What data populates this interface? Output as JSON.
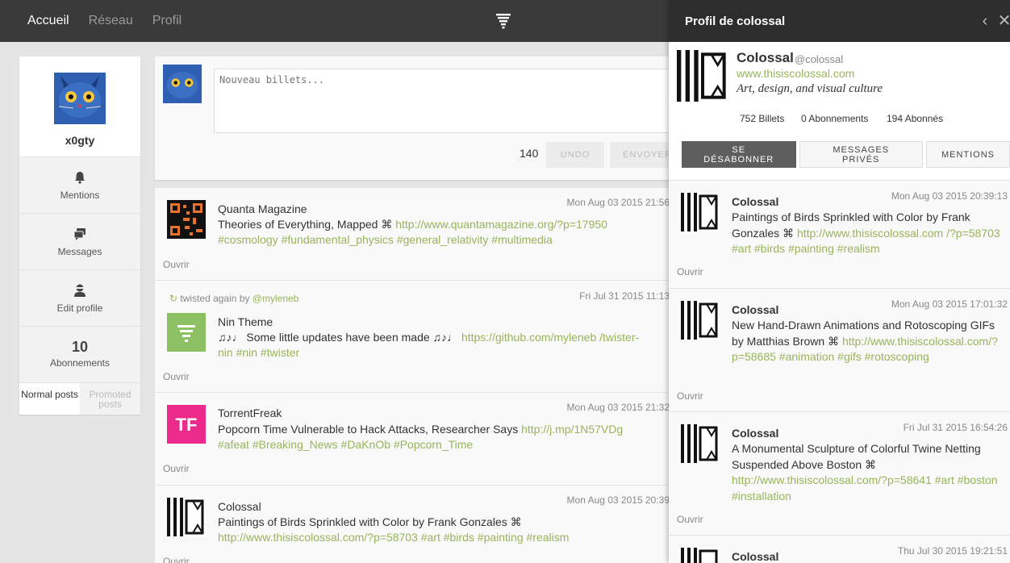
{
  "nav": {
    "items": [
      "Accueil",
      "Réseau",
      "Profil"
    ]
  },
  "user": {
    "name": "x0gty"
  },
  "sidebar": {
    "mentions": "Mentions",
    "messages": "Messages",
    "edit_profile": "Edit profile",
    "following_count": "10",
    "following_label": "Abonnements",
    "tab_normal": "Normal posts",
    "tab_promoted": "Promoted posts"
  },
  "composer": {
    "placeholder": "Nouveau billets...",
    "counter": "140",
    "undo": "UNDO",
    "send": "ENVOYER"
  },
  "feed": [
    {
      "name": "Quanta Magazine",
      "time": "Mon Aug 03 2015 21:56",
      "text": "Theories of Everything, Mapped ⌘ ",
      "link": "http://www.quantamagazine.org/?p=17950",
      "tags": "#cosmology #fundamental_physics #general_relativity #multimedia",
      "open": "Ouvrir"
    },
    {
      "retwist_prefix": "twisted again by ",
      "retwist_user": "@myleneb",
      "name": "Nin Theme",
      "time": "Fri Jul 31 2015 11:13",
      "text": "♫♪♩ Some little updates have been made ♫♪♩ ",
      "link": "https://github.com/myleneb /twister-nin",
      "tags": "#nin #twister",
      "open": "Ouvrir"
    },
    {
      "name": "TorrentFreak",
      "time": "Mon Aug 03 2015 21:32",
      "text": "Popcorn Time Vulnerable to Hack Attacks, Researcher Says ",
      "link": "http://j.mp/1N57VDg",
      "tags": "#afeat #Breaking_News #DaKnOb #Popcorn_Time",
      "open": "Ouvrir"
    },
    {
      "name": "Colossal",
      "time": "Mon Aug 03 2015 20:39",
      "text": "Paintings of Birds Sprinkled with Color by Frank Gonzales ⌘",
      "link": "http://www.thisiscolossal.com/?p=58703",
      "tags": "#art #birds #painting #realism",
      "open": "Ouvrir"
    }
  ],
  "panel": {
    "title": "Profil de colossal",
    "name": "Colossal",
    "handle": "@colossal",
    "url": "www.thisiscolossal.com",
    "bio": "Art, design, and visual culture",
    "posts": "752 Billets",
    "following": "0 Abonnements",
    "followers": "194 Abonnés",
    "btn_unfollow": "SE DÉSABONNER",
    "btn_dm": "MESSAGES PRIVÉS",
    "btn_mentions": "MENTIONS",
    "posts_list": [
      {
        "name": "Colossal",
        "time": "Mon Aug 03 2015 20:39:13",
        "text": "Paintings of Birds Sprinkled with Color by Frank Gonzales ⌘ ",
        "link": "http://www.thisiscolossal.com /?p=58703",
        "tags": "#art #birds #painting #realism",
        "open": "Ouvrir"
      },
      {
        "name": "Colossal",
        "time": "Mon Aug 03 2015 17:01:32",
        "text": "New Hand-Drawn Animations and Rotoscoping GIFs by Matthias Brown ⌘ ",
        "link": "http://www.thisiscolossal.com/?p=58685",
        "tags": "#animation #gifs #rotoscoping",
        "open": "Ouvrir"
      },
      {
        "name": "Colossal",
        "time": "Fri Jul 31 2015 16:54:26",
        "text": "A Monumental Sculpture of Colorful Twine Netting Suspended Above Boston ⌘ ",
        "link": "http://www.thisiscolossal.com/?p=58641",
        "tags": "#art #boston #installation",
        "open": "Ouvrir"
      },
      {
        "name": "Colossal",
        "time": "Thu Jul 30 2015 19:21:51"
      }
    ]
  }
}
